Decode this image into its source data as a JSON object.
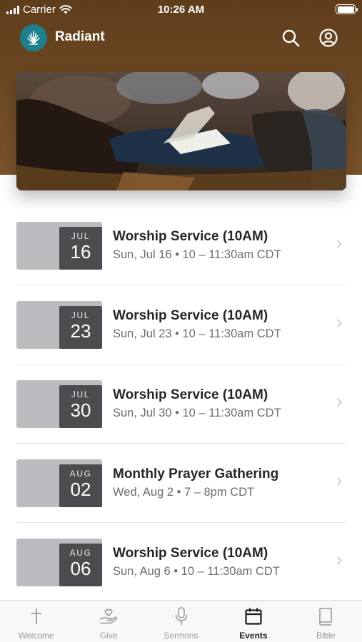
{
  "status_bar": {
    "carrier": "Carrier",
    "time": "10:26 AM"
  },
  "app_bar": {
    "title": "Radiant"
  },
  "events": [
    {
      "month": "JUL",
      "day": "16",
      "title": "Worship Service (10AM)",
      "meta": "Sun, Jul 16 • 10 – 11:30am CDT"
    },
    {
      "month": "JUL",
      "day": "23",
      "title": "Worship Service (10AM)",
      "meta": "Sun, Jul 23 • 10 – 11:30am CDT"
    },
    {
      "month": "JUL",
      "day": "30",
      "title": "Worship Service (10AM)",
      "meta": "Sun, Jul 30 • 10 – 11:30am CDT"
    },
    {
      "month": "AUG",
      "day": "02",
      "title": "Monthly Prayer Gathering",
      "meta": "Wed, Aug 2 • 7 – 8pm CDT"
    },
    {
      "month": "AUG",
      "day": "06",
      "title": "Worship Service (10AM)",
      "meta": "Sun, Aug 6 • 10 – 11:30am CDT"
    }
  ],
  "tabs": [
    {
      "label": "Welcome",
      "icon": "cross-icon",
      "active": false
    },
    {
      "label": "Give",
      "icon": "give-hand-heart-icon",
      "active": false
    },
    {
      "label": "Sermons",
      "icon": "microphone-icon",
      "active": false
    },
    {
      "label": "Events",
      "icon": "calendar-icon",
      "active": true
    },
    {
      "label": "Bible",
      "icon": "book-icon",
      "active": false
    }
  ],
  "colors": {
    "header_brown": "#6e4a24",
    "logo_teal": "#1f7f8c",
    "date_box": "#4b4c4f",
    "date_tile": "#bbbcbf"
  }
}
